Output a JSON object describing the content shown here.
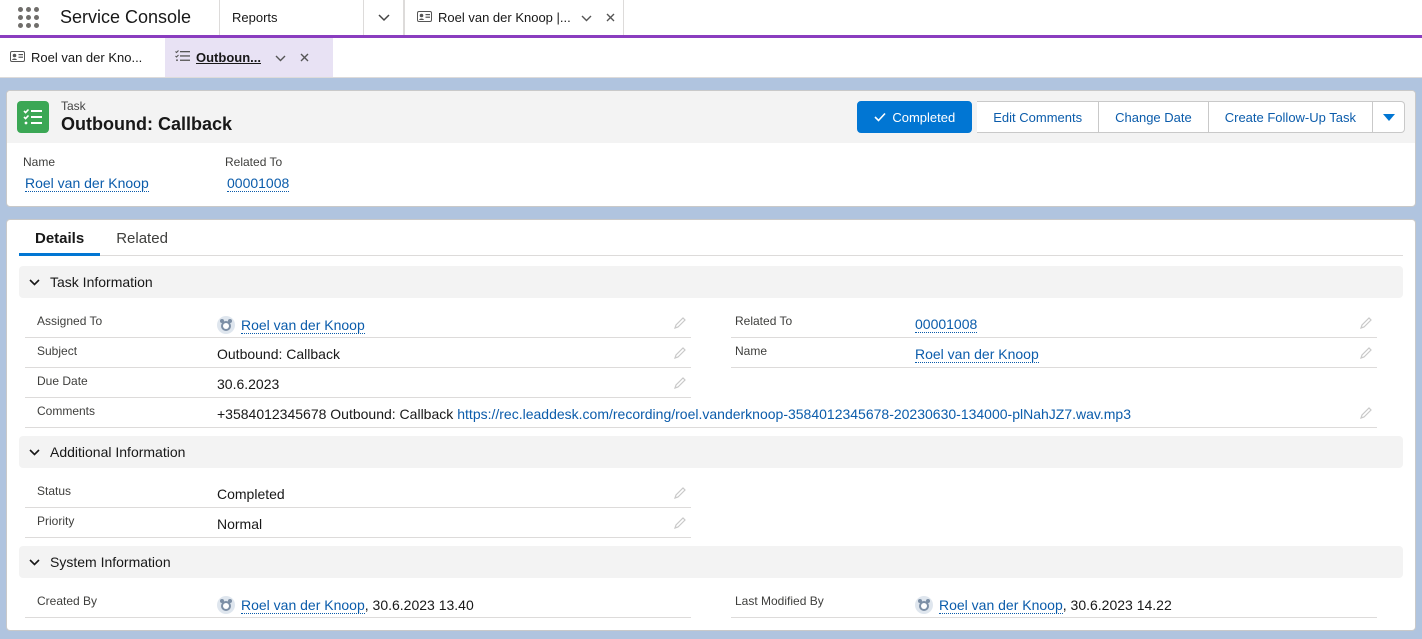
{
  "topbar": {
    "app_name": "Service Console",
    "nav_item": "Reports",
    "workspace_tab": "Roel van der Knoop |..."
  },
  "subtabs": [
    {
      "label": "Roel van der Kno..."
    },
    {
      "label": "Outboun..."
    }
  ],
  "header": {
    "object_type": "Task",
    "title": "Outbound: Callback",
    "actions": {
      "completed": "Completed",
      "edit_comments": "Edit Comments",
      "change_date": "Change Date",
      "follow_up": "Create Follow-Up Task"
    },
    "highlights": [
      {
        "label": "Name",
        "value": "Roel van der Knoop"
      },
      {
        "label": "Related To",
        "value": "00001008"
      }
    ]
  },
  "tabs": {
    "details": "Details",
    "related": "Related"
  },
  "sections": {
    "task_info": {
      "title": "Task Information",
      "assigned_to_label": "Assigned To",
      "assigned_to": "Roel van der Knoop",
      "subject_label": "Subject",
      "subject": "Outbound: Callback",
      "due_date_label": "Due Date",
      "due_date": "30.6.2023",
      "comments_label": "Comments",
      "comments_text": "+3584012345678 Outbound: Callback",
      "comments_link": "https://rec.leaddesk.com/recording/roel.vanderknoop-3584012345678-20230630-134000-plNahJZ7.wav.mp3",
      "related_to_label": "Related To",
      "related_to": "00001008",
      "name_label": "Name",
      "name": "Roel van der Knoop"
    },
    "additional_info": {
      "title": "Additional Information",
      "status_label": "Status",
      "status": "Completed",
      "priority_label": "Priority",
      "priority": "Normal"
    },
    "system_info": {
      "title": "System Information",
      "created_by_label": "Created By",
      "created_by": "Roel van der Knoop",
      "created_date": ", 30.6.2023 13.40",
      "modified_by_label": "Last Modified By",
      "modified_by": "Roel van der Knoop",
      "modified_date": ", 30.6.2023 14.22"
    }
  },
  "colors": {
    "accent": "#0176d3",
    "task_icon": "#3ba755",
    "workspace_bar": "#8a3dbf"
  }
}
